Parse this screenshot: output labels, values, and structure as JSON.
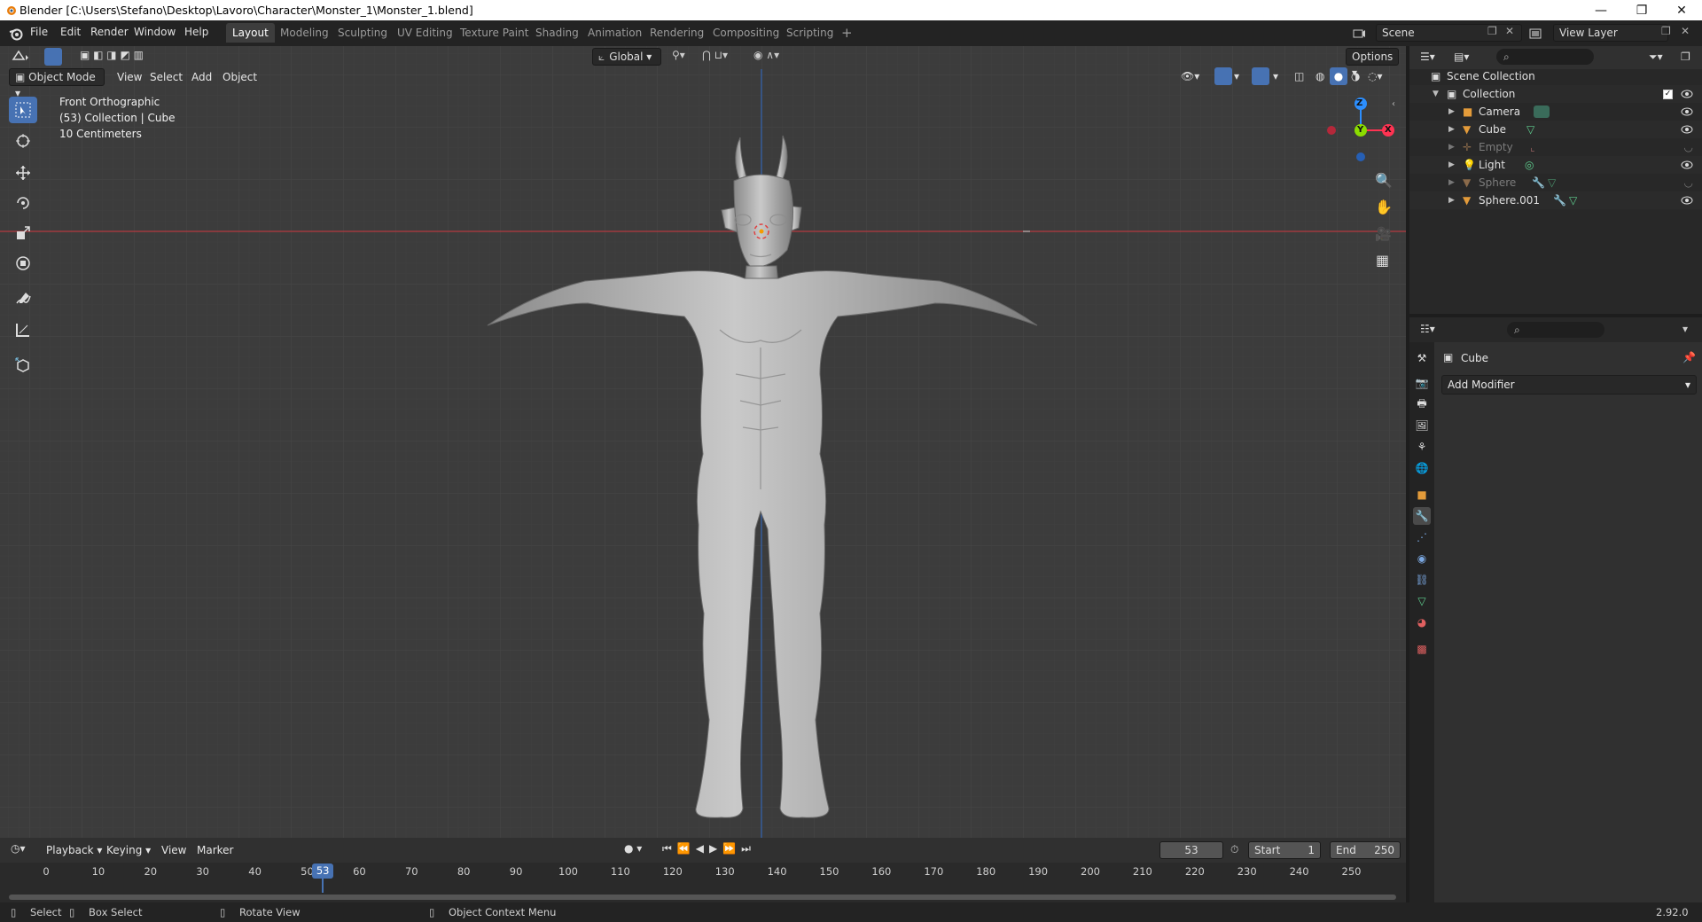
{
  "window": {
    "title": "Blender [C:\\Users\\Stefano\\Desktop\\Lavoro\\Character\\Monster_1\\Monster_1.blend]"
  },
  "menus": [
    "File",
    "Edit",
    "Render",
    "Window",
    "Help"
  ],
  "workspaces": [
    {
      "label": "Layout",
      "active": true
    },
    {
      "label": "Modeling"
    },
    {
      "label": "Sculpting"
    },
    {
      "label": "UV Editing"
    },
    {
      "label": "Texture Paint"
    },
    {
      "label": "Shading"
    },
    {
      "label": "Animation"
    },
    {
      "label": "Rendering"
    },
    {
      "label": "Compositing"
    },
    {
      "label": "Scripting"
    }
  ],
  "scene": {
    "name": "Scene",
    "view_layer": "View Layer"
  },
  "viewport": {
    "mode": "Object Mode",
    "menus": [
      "View",
      "Select",
      "Add",
      "Object"
    ],
    "orientation": "Global",
    "options_label": "Options",
    "overlay_lines": [
      "Front Orthographic",
      "(53) Collection | Cube",
      "10 Centimeters"
    ],
    "gizmo": {
      "z": "Z",
      "y": "Y",
      "x": "X"
    }
  },
  "outliner": {
    "root": "Scene Collection",
    "collection": "Collection",
    "items": [
      {
        "name": "Camera",
        "dim": false
      },
      {
        "name": "Cube",
        "dim": false
      },
      {
        "name": "Empty",
        "dim": true
      },
      {
        "name": "Light",
        "dim": false
      },
      {
        "name": "Sphere",
        "dim": true
      },
      {
        "name": "Sphere.001",
        "dim": false
      }
    ]
  },
  "properties": {
    "object": "Cube",
    "add_modifier": "Add Modifier"
  },
  "timeline": {
    "menus": [
      "Playback",
      "Keying",
      "View",
      "Marker"
    ],
    "current_frame": "53",
    "start_label": "Start",
    "start": "1",
    "end_label": "End",
    "end": "250",
    "ticks": [
      "0",
      "10",
      "20",
      "30",
      "40",
      "50",
      "60",
      "70",
      "80",
      "90",
      "100",
      "110",
      "120",
      "130",
      "140",
      "150",
      "160",
      "170",
      "180",
      "190",
      "200",
      "210",
      "220",
      "230",
      "240",
      "250"
    ]
  },
  "status": {
    "select": "Select",
    "box_select": "Box Select",
    "rotate_view": "Rotate View",
    "context_menu": "Object Context Menu",
    "version": "2.92.0"
  },
  "colors": {
    "accent": "#4772b3",
    "x_axis": "#ff3352",
    "y_axis": "#8bdc00",
    "z_axis": "#2c8fff",
    "viewport_bg": "#3c3c3c"
  }
}
